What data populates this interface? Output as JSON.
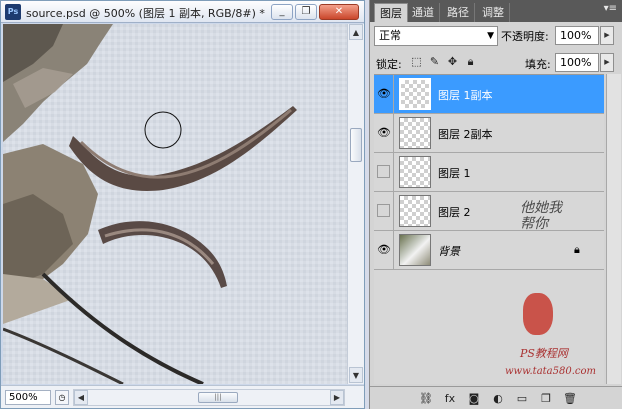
{
  "document": {
    "title": "source.psd @ 500% (图层 1 副本, RGB/8#) *",
    "app_icon": "Ps",
    "zoom": "500%",
    "window_buttons": [
      {
        "name": "minimize-icon",
        "glyph": "_"
      },
      {
        "name": "restore-icon",
        "glyph": "❐"
      },
      {
        "name": "close-icon",
        "glyph": "✕"
      }
    ]
  },
  "panel": {
    "tabs": [
      "图层",
      "通道",
      "路径",
      "调整"
    ],
    "active_tab": 0,
    "blend_mode": "正常",
    "opacity_label": "不透明度:",
    "opacity_value": "100%",
    "lock_label": "锁定:",
    "fill_label": "填充:",
    "fill_value": "100%",
    "layers": [
      {
        "name": "图层 1副本",
        "visible": true,
        "selected": true,
        "thumbnail": "transparent"
      },
      {
        "name": "图层 2副本",
        "visible": true,
        "selected": false,
        "thumbnail": "transparent"
      },
      {
        "name": "图层 1",
        "visible": false,
        "selected": false,
        "thumbnail": "transparent"
      },
      {
        "name": "图层 2",
        "visible": false,
        "selected": false,
        "thumbnail": "transparent"
      },
      {
        "name": "背景",
        "visible": true,
        "selected": false,
        "thumbnail": "photo",
        "locked": true
      }
    ]
  },
  "watermark": {
    "vertical_text": "他她我帮你",
    "site_name": "PS教程网",
    "url": "www.tata580.com"
  },
  "colors": {
    "selection": "#3b9bff",
    "panel_tab_bar": "#595959"
  }
}
